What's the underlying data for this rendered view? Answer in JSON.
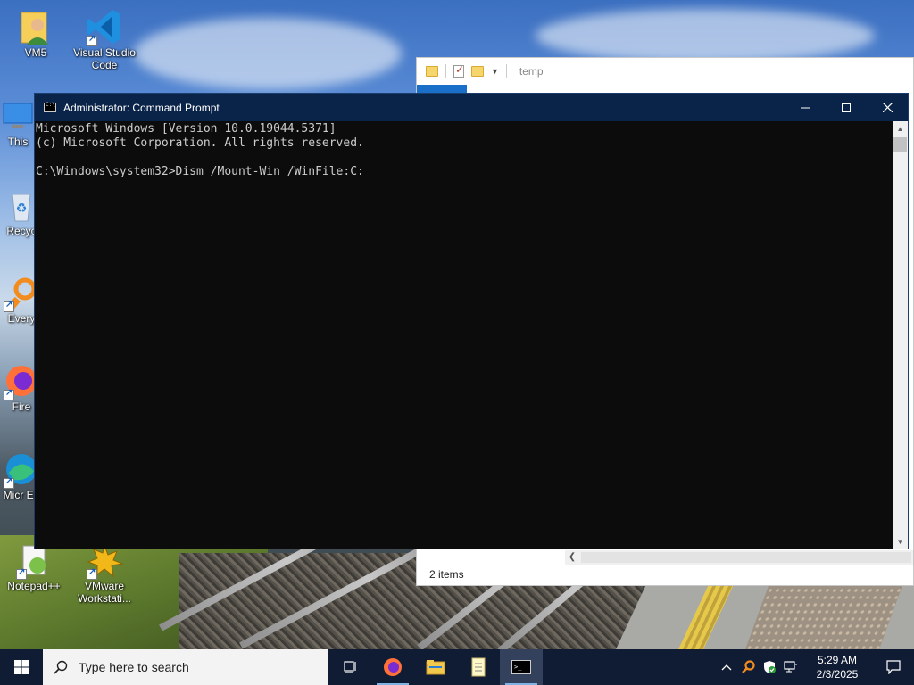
{
  "desktop": {
    "icons": [
      {
        "label": "VM5"
      },
      {
        "label": "Visual Studio Code"
      },
      {
        "label": "This"
      },
      {
        "label": "Recyc"
      },
      {
        "label": "Every"
      },
      {
        "label": "Fire"
      },
      {
        "label": "Micr Ed"
      },
      {
        "label": "Notepad++"
      },
      {
        "label": "VMware Workstati..."
      }
    ]
  },
  "explorer": {
    "title": "temp",
    "status": "2 items"
  },
  "cmd": {
    "title": "Administrator: Command Prompt",
    "lines": [
      "Microsoft Windows [Version 10.0.19044.5371]",
      "(c) Microsoft Corporation. All rights reserved.",
      "",
      "C:\\Windows\\system32>Dism /Mount-Win /WinFile:C:"
    ]
  },
  "taskbar": {
    "search_placeholder": "Type here to search",
    "apps": [
      "task-view",
      "firefox",
      "file-explorer",
      "notepad",
      "command-prompt"
    ],
    "time": "5:29 AM",
    "date": "2/3/2025"
  },
  "colors": {
    "taskbar": "#101c33",
    "cmd_titlebar": "#0a2348",
    "console_bg": "#0c0c0c",
    "console_text": "#cccccc"
  }
}
